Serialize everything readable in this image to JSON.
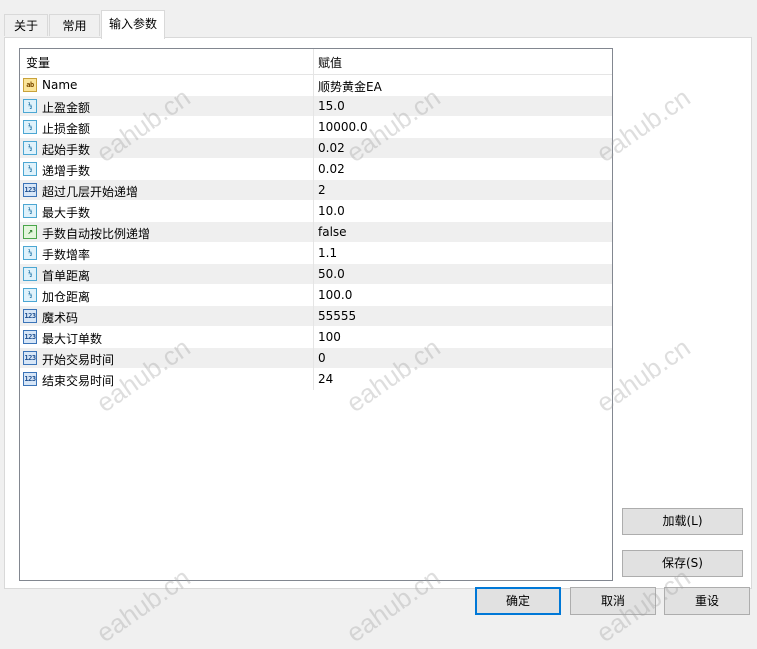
{
  "tabs": [
    {
      "label": "关于"
    },
    {
      "label": "常用"
    },
    {
      "label": "输入参数"
    }
  ],
  "table": {
    "col_variable": "变量",
    "col_value": "赋值",
    "rows": [
      {
        "icon": "ab-icon",
        "type_glyph": "ab",
        "name": "Name",
        "value": "顺势黄金EA"
      },
      {
        "icon": "double-icon",
        "type_glyph": "½",
        "name": "止盈金额",
        "value": "15.0"
      },
      {
        "icon": "double-icon",
        "type_glyph": "½",
        "name": "止损金额",
        "value": "10000.0"
      },
      {
        "icon": "double-icon",
        "type_glyph": "½",
        "name": "起始手数",
        "value": "0.02"
      },
      {
        "icon": "double-icon",
        "type_glyph": "½",
        "name": "递增手数",
        "value": "0.02"
      },
      {
        "icon": "integer-icon",
        "type_glyph": "123",
        "name": "超过几层开始递增",
        "value": "2"
      },
      {
        "icon": "double-icon",
        "type_glyph": "½",
        "name": "最大手数",
        "value": "10.0"
      },
      {
        "icon": "bool-icon",
        "type_glyph": "↗",
        "name": "手数自动按比例递增",
        "value": "false"
      },
      {
        "icon": "double-icon",
        "type_glyph": "½",
        "name": "手数增率",
        "value": "1.1"
      },
      {
        "icon": "double-icon",
        "type_glyph": "½",
        "name": "首单距离",
        "value": "50.0"
      },
      {
        "icon": "double-icon",
        "type_glyph": "½",
        "name": "加仓距离",
        "value": "100.0"
      },
      {
        "icon": "integer-icon",
        "type_glyph": "123",
        "name": "魔术码",
        "value": "55555"
      },
      {
        "icon": "integer-icon",
        "type_glyph": "123",
        "name": "最大订单数",
        "value": "100"
      },
      {
        "icon": "integer-icon",
        "type_glyph": "123",
        "name": "开始交易时间",
        "value": "0"
      },
      {
        "icon": "integer-icon",
        "type_glyph": "123",
        "name": "结束交易时间",
        "value": "24"
      }
    ]
  },
  "buttons": {
    "load": "加载(L)",
    "save": "保存(S)",
    "ok": "确定",
    "cancel": "取消",
    "reset": "重设"
  },
  "watermark": "eahub.cn"
}
